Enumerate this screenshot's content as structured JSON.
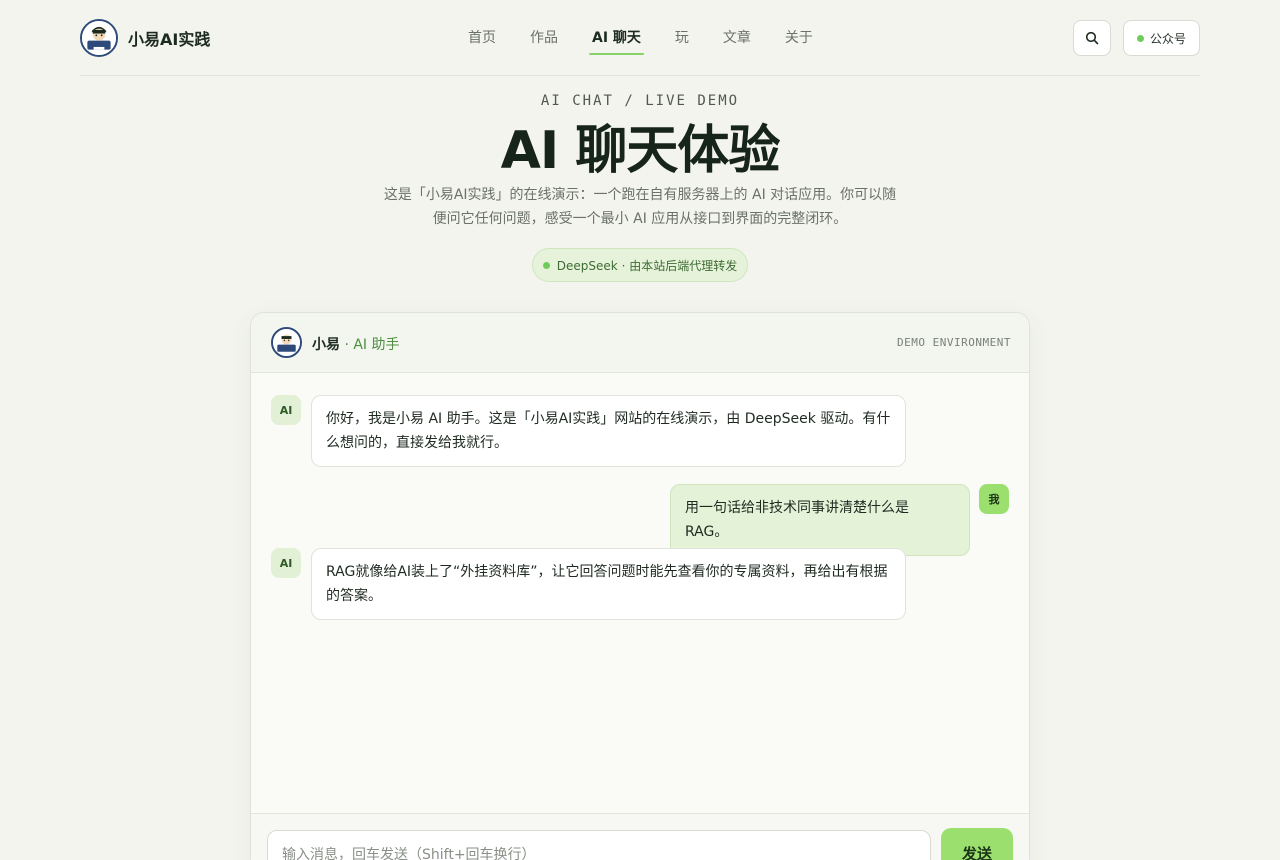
{
  "header": {
    "brand_name": "小易AI实践",
    "nav": [
      {
        "label": "首页"
      },
      {
        "label": "作品"
      },
      {
        "label": "AI 聊天"
      },
      {
        "label": "玩"
      },
      {
        "label": "文章"
      },
      {
        "label": "关于"
      }
    ],
    "active_nav": "AI 聊天",
    "wechat_label": "公众号"
  },
  "hero": {
    "eyebrow": "AI CHAT / LIVE DEMO",
    "title": "AI 聊天体验",
    "description": "这是「小易AI实践」的在线演示：一个跑在自有服务器上的 AI 对话应用。你可以随便问它任何问题，感受一个最小 AI 应用从接口到界面的完整闭环。",
    "badge": "DeepSeek · 由本站后端代理转发"
  },
  "chat": {
    "assistant_name": "小易",
    "assistant_role": " · AI 助手",
    "environment": "DEMO ENVIRONMENT",
    "messages": [
      {
        "role": "ai",
        "tag": "AI",
        "text": "你好，我是小易 AI 助手。这是「小易AI实践」网站的在线演示，由 DeepSeek 驱动。有什么想问的，直接发给我就行。"
      },
      {
        "role": "me",
        "tag": "我",
        "text": "用一句话给非技术同事讲清楚什么是 RAG。"
      },
      {
        "role": "ai",
        "tag": "AI",
        "text": "RAG就像给AI装上了“外挂资料库”，让它回答问题时能先查看你的专属资料，再给出有根据的答案。"
      }
    ],
    "input_placeholder": "输入消息，回车发送（Shift+回车换行）",
    "input_value": "",
    "send_label": "发送"
  },
  "colors": {
    "accent": "#9be06f",
    "accent_dark": "#4d8f3f",
    "status_dot": "#6fcc5a",
    "background": "#f3f4ee"
  },
  "icons": {
    "search": "search-icon",
    "status": "online-dot-icon"
  }
}
